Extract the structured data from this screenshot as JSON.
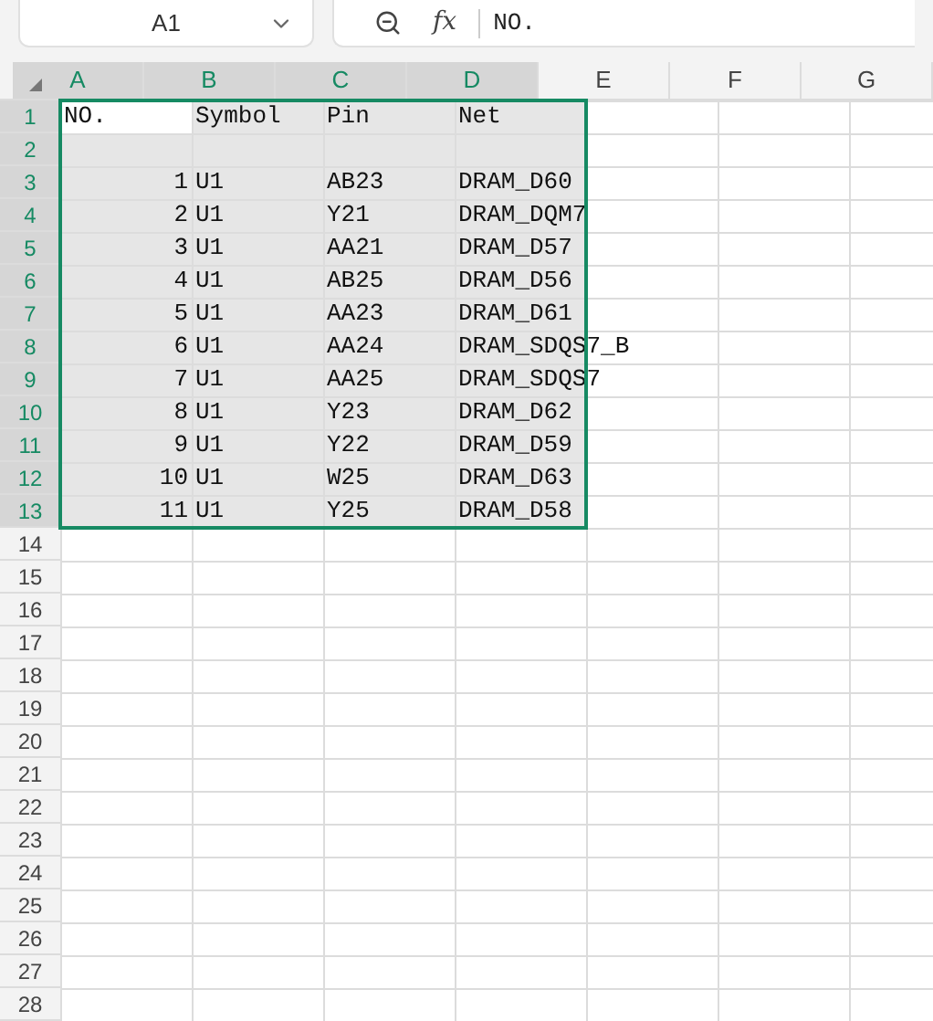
{
  "name_box": {
    "value": "A1"
  },
  "formula_bar": {
    "fx_label": "fx",
    "value": "NO."
  },
  "columns": [
    {
      "label": "A",
      "selected": true
    },
    {
      "label": "B",
      "selected": true
    },
    {
      "label": "C",
      "selected": true
    },
    {
      "label": "D",
      "selected": true
    },
    {
      "label": "E",
      "selected": false
    },
    {
      "label": "F",
      "selected": false
    },
    {
      "label": "G",
      "selected": false
    }
  ],
  "rows": [
    {
      "number": "1",
      "selected": true,
      "cells": [
        {
          "text": "NO.",
          "kind": "text",
          "active": true
        },
        {
          "text": "Symbol",
          "kind": "text",
          "active": false
        },
        {
          "text": "Pin",
          "kind": "text",
          "active": false
        },
        {
          "text": "Net",
          "kind": "text",
          "active": false
        }
      ]
    },
    {
      "number": "2",
      "selected": true
    },
    {
      "number": "3",
      "selected": true,
      "cells": [
        {
          "text": "1",
          "kind": "number",
          "active": false
        },
        {
          "text": "U1",
          "kind": "text",
          "active": false
        },
        {
          "text": "AB23",
          "kind": "text",
          "active": false
        },
        {
          "text": "DRAM_D60",
          "kind": "text",
          "active": false
        }
      ]
    },
    {
      "number": "4",
      "selected": true,
      "cells": [
        {
          "text": "2",
          "kind": "number",
          "active": false
        },
        {
          "text": "U1",
          "kind": "text",
          "active": false
        },
        {
          "text": "Y21",
          "kind": "text",
          "active": false
        },
        {
          "text": "DRAM_DQM7",
          "kind": "text",
          "active": false
        }
      ]
    },
    {
      "number": "5",
      "selected": true,
      "cells": [
        {
          "text": "3",
          "kind": "number",
          "active": false
        },
        {
          "text": "U1",
          "kind": "text",
          "active": false
        },
        {
          "text": "AA21",
          "kind": "text",
          "active": false
        },
        {
          "text": "DRAM_D57",
          "kind": "text",
          "active": false
        }
      ]
    },
    {
      "number": "6",
      "selected": true,
      "cells": [
        {
          "text": "4",
          "kind": "number",
          "active": false
        },
        {
          "text": "U1",
          "kind": "text",
          "active": false
        },
        {
          "text": "AB25",
          "kind": "text",
          "active": false
        },
        {
          "text": "DRAM_D56",
          "kind": "text",
          "active": false
        }
      ]
    },
    {
      "number": "7",
      "selected": true,
      "cells": [
        {
          "text": "5",
          "kind": "number",
          "active": false
        },
        {
          "text": "U1",
          "kind": "text",
          "active": false
        },
        {
          "text": "AA23",
          "kind": "text",
          "active": false
        },
        {
          "text": "DRAM_D61",
          "kind": "text",
          "active": false
        }
      ]
    },
    {
      "number": "8",
      "selected": true,
      "cells": [
        {
          "text": "6",
          "kind": "number",
          "active": false
        },
        {
          "text": "U1",
          "kind": "text",
          "active": false
        },
        {
          "text": "AA24",
          "kind": "text",
          "active": false
        },
        {
          "text": "DRAM_SDQS7_B",
          "kind": "text",
          "active": false
        }
      ]
    },
    {
      "number": "9",
      "selected": true,
      "cells": [
        {
          "text": "7",
          "kind": "number",
          "active": false
        },
        {
          "text": "U1",
          "kind": "text",
          "active": false
        },
        {
          "text": "AA25",
          "kind": "text",
          "active": false
        },
        {
          "text": "DRAM_SDQS7",
          "kind": "text",
          "active": false
        }
      ]
    },
    {
      "number": "10",
      "selected": true,
      "cells": [
        {
          "text": "8",
          "kind": "number",
          "active": false
        },
        {
          "text": "U1",
          "kind": "text",
          "active": false
        },
        {
          "text": "Y23",
          "kind": "text",
          "active": false
        },
        {
          "text": "DRAM_D62",
          "kind": "text",
          "active": false
        }
      ]
    },
    {
      "number": "11",
      "selected": true,
      "cells": [
        {
          "text": "9",
          "kind": "number",
          "active": false
        },
        {
          "text": "U1",
          "kind": "text",
          "active": false
        },
        {
          "text": "Y22",
          "kind": "text",
          "active": false
        },
        {
          "text": "DRAM_D59",
          "kind": "text",
          "active": false
        }
      ]
    },
    {
      "number": "12",
      "selected": true,
      "cells": [
        {
          "text": "10",
          "kind": "number",
          "active": false
        },
        {
          "text": "U1",
          "kind": "text",
          "active": false
        },
        {
          "text": "W25",
          "kind": "text",
          "active": false
        },
        {
          "text": "DRAM_D63",
          "kind": "text",
          "active": false
        }
      ]
    },
    {
      "number": "13",
      "selected": true,
      "cells": [
        {
          "text": "11",
          "kind": "number",
          "active": false
        },
        {
          "text": "U1",
          "kind": "text",
          "active": false
        },
        {
          "text": "Y25",
          "kind": "text",
          "active": false
        },
        {
          "text": "DRAM_D58",
          "kind": "text",
          "active": false
        }
      ]
    },
    {
      "number": "14",
      "selected": false
    },
    {
      "number": "15",
      "selected": false
    },
    {
      "number": "16",
      "selected": false
    },
    {
      "number": "17",
      "selected": false
    },
    {
      "number": "18",
      "selected": false
    },
    {
      "number": "19",
      "selected": false
    },
    {
      "number": "20",
      "selected": false
    },
    {
      "number": "21",
      "selected": false
    },
    {
      "number": "22",
      "selected": false
    },
    {
      "number": "23",
      "selected": false
    },
    {
      "number": "24",
      "selected": false
    },
    {
      "number": "25",
      "selected": false
    },
    {
      "number": "26",
      "selected": false
    },
    {
      "number": "27",
      "selected": false
    },
    {
      "number": "28",
      "selected": false
    }
  ]
}
